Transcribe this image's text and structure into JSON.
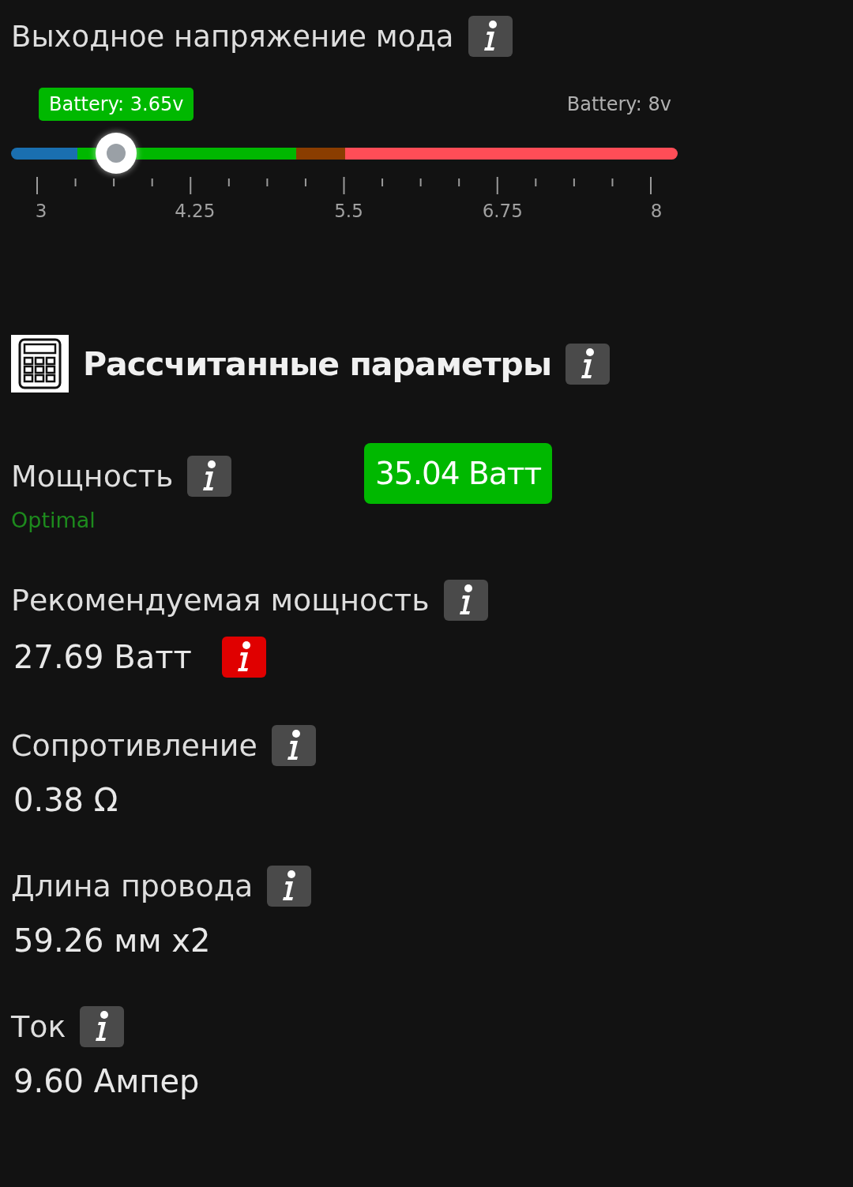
{
  "voltage": {
    "title": "Выходное напряжение мода",
    "current_label": "Battery: 3.65v",
    "max_label": "Battery: 8v",
    "level": 0.158,
    "zones": [
      {
        "color": "#1a6fb0"
      },
      {
        "color": "#00b800"
      },
      {
        "color": "#8a3d00"
      },
      {
        "color": "#ff4d57"
      }
    ],
    "ticks": [
      "3",
      "4.25",
      "5.5",
      "6.75",
      "8"
    ]
  },
  "section": {
    "title": "Рассчитанные параметры"
  },
  "params": [
    {
      "label": "Мощность",
      "kind": "badge",
      "value": "35.04 Ватт",
      "status": "Optimal"
    },
    {
      "label": "Рекомендуемая мощность",
      "kind": "plain",
      "value": "27.69 Ватт",
      "alert": true
    },
    {
      "label": "Сопротивление",
      "kind": "plain",
      "value": "0.38 Ω",
      "alert": false
    },
    {
      "label": "Длина провода",
      "kind": "plain",
      "value": "59.26 мм x2",
      "alert": false
    },
    {
      "label": "Ток",
      "kind": "plain",
      "value": "9.60 Ампер",
      "alert": false
    }
  ]
}
